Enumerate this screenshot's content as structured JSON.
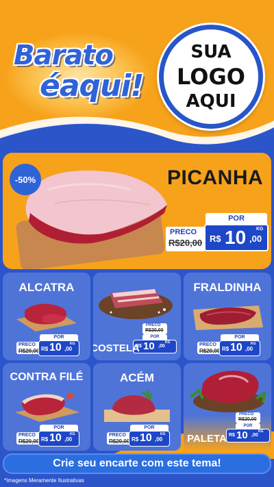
{
  "header": {
    "brand_line1": "Barato",
    "brand_line2": "éaqui!",
    "logo_lines": [
      "SUA",
      "LOGO",
      "AQUI"
    ]
  },
  "hero": {
    "discount": "-50%",
    "name": "PICANHA",
    "tag": {
      "preco_label": "PRECO",
      "old_price": "R$20,00",
      "por_label": "POR",
      "currency": "R$",
      "price_int": "10",
      "price_cents": ",00",
      "unit": "KG"
    }
  },
  "products": [
    {
      "name": "ALCATRA",
      "preco_label": "PRECO",
      "old_price": "R$20,00",
      "por_label": "POR",
      "currency": "R$",
      "price_int": "10",
      "price_cents": ",00",
      "unit": "KG"
    },
    {
      "name": "COSTELA",
      "preco_label": "PRECO",
      "old_price": "R$20,00",
      "por_label": "POR",
      "currency": "R$",
      "price_int": "10",
      "price_cents": ",00",
      "unit": "KG"
    },
    {
      "name": "FRALDINHA",
      "preco_label": "PRECO",
      "old_price": "R$20,00",
      "por_label": "POR",
      "currency": "R$",
      "price_int": "10",
      "price_cents": ",00",
      "unit": "KG"
    },
    {
      "name": "CONTRA FILÉ",
      "preco_label": "PRECO",
      "old_price": "R$20,00",
      "por_label": "POR",
      "currency": "R$",
      "price_int": "10",
      "price_cents": ",00",
      "unit": "KG"
    },
    {
      "name": "ACÉM",
      "preco_label": "PRECO",
      "old_price": "R$20,00",
      "por_label": "POR",
      "currency": "R$",
      "price_int": "10",
      "price_cents": ",00",
      "unit": "KG"
    },
    {
      "name": "PALETA",
      "preco_label": "PRECO",
      "old_price": "R$20,00",
      "por_label": "POR",
      "currency": "R$",
      "price_int": "10",
      "price_cents": ",00",
      "unit": "KG"
    }
  ],
  "cta": {
    "label": "Crie seu encarte com este tema!"
  },
  "footnote": "*Imagens Meramente Ilustrativas",
  "colors": {
    "orange": "#f7a21b",
    "blue": "#2b55c9",
    "card_blue": "#4f74d8",
    "price_blue": "#1e47c8"
  }
}
